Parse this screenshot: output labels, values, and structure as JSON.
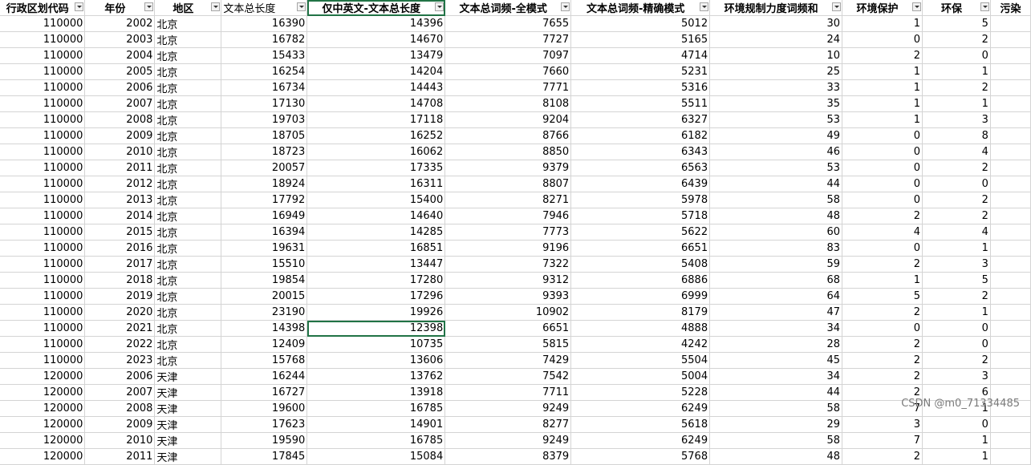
{
  "columns": [
    "行政区划代码",
    "年份",
    "地区",
    "文本总长度",
    "仅中英文-文本总长度",
    "文本总词频-全模式",
    "文本总词频-精确模式",
    "环境规制力度词频和",
    "环境保护",
    "环保",
    "污染"
  ],
  "rows": [
    [
      "110000",
      "2002",
      "北京",
      "16390",
      "14396",
      "7655",
      "5012",
      "30",
      "1",
      "5"
    ],
    [
      "110000",
      "2003",
      "北京",
      "16782",
      "14670",
      "7727",
      "5165",
      "24",
      "0",
      "2"
    ],
    [
      "110000",
      "2004",
      "北京",
      "15433",
      "13479",
      "7097",
      "4714",
      "10",
      "2",
      "0"
    ],
    [
      "110000",
      "2005",
      "北京",
      "16254",
      "14204",
      "7660",
      "5231",
      "25",
      "1",
      "1"
    ],
    [
      "110000",
      "2006",
      "北京",
      "16734",
      "14443",
      "7771",
      "5316",
      "33",
      "1",
      "2"
    ],
    [
      "110000",
      "2007",
      "北京",
      "17130",
      "14708",
      "8108",
      "5511",
      "35",
      "1",
      "1"
    ],
    [
      "110000",
      "2008",
      "北京",
      "19703",
      "17118",
      "9204",
      "6327",
      "53",
      "1",
      "3"
    ],
    [
      "110000",
      "2009",
      "北京",
      "18705",
      "16252",
      "8766",
      "6182",
      "49",
      "0",
      "8"
    ],
    [
      "110000",
      "2010",
      "北京",
      "18723",
      "16062",
      "8850",
      "6343",
      "46",
      "0",
      "4"
    ],
    [
      "110000",
      "2011",
      "北京",
      "20057",
      "17335",
      "9379",
      "6563",
      "53",
      "0",
      "2"
    ],
    [
      "110000",
      "2012",
      "北京",
      "18924",
      "16311",
      "8807",
      "6439",
      "44",
      "0",
      "0"
    ],
    [
      "110000",
      "2013",
      "北京",
      "17792",
      "15400",
      "8271",
      "5978",
      "58",
      "0",
      "2"
    ],
    [
      "110000",
      "2014",
      "北京",
      "16949",
      "14640",
      "7946",
      "5718",
      "48",
      "2",
      "2"
    ],
    [
      "110000",
      "2015",
      "北京",
      "16394",
      "14285",
      "7773",
      "5622",
      "60",
      "4",
      "4"
    ],
    [
      "110000",
      "2016",
      "北京",
      "19631",
      "16851",
      "9196",
      "6651",
      "83",
      "0",
      "1"
    ],
    [
      "110000",
      "2017",
      "北京",
      "15510",
      "13447",
      "7322",
      "5408",
      "59",
      "2",
      "3"
    ],
    [
      "110000",
      "2018",
      "北京",
      "19854",
      "17280",
      "9312",
      "6886",
      "68",
      "1",
      "5"
    ],
    [
      "110000",
      "2019",
      "北京",
      "20015",
      "17296",
      "9393",
      "6999",
      "64",
      "5",
      "2"
    ],
    [
      "110000",
      "2020",
      "北京",
      "23190",
      "19926",
      "10902",
      "8179",
      "47",
      "2",
      "1"
    ],
    [
      "110000",
      "2021",
      "北京",
      "14398",
      "12398",
      "6651",
      "4888",
      "34",
      "0",
      "0"
    ],
    [
      "110000",
      "2022",
      "北京",
      "12409",
      "10735",
      "5815",
      "4242",
      "28",
      "2",
      "0"
    ],
    [
      "110000",
      "2023",
      "北京",
      "15768",
      "13606",
      "7429",
      "5504",
      "45",
      "2",
      "2"
    ],
    [
      "120000",
      "2006",
      "天津",
      "16244",
      "13762",
      "7542",
      "5004",
      "34",
      "2",
      "3"
    ],
    [
      "120000",
      "2007",
      "天津",
      "16727",
      "13918",
      "7711",
      "5228",
      "44",
      "2",
      "6"
    ],
    [
      "120000",
      "2008",
      "天津",
      "19600",
      "16785",
      "9249",
      "6249",
      "58",
      "7",
      "1"
    ],
    [
      "120000",
      "2009",
      "天津",
      "17623",
      "14901",
      "8277",
      "5618",
      "29",
      "3",
      "0"
    ],
    [
      "120000",
      "2010",
      "天津",
      "19590",
      "16785",
      "9249",
      "6249",
      "58",
      "7",
      "1"
    ],
    [
      "120000",
      "2011",
      "天津",
      "17845",
      "15084",
      "8379",
      "5768",
      "48",
      "2",
      "1"
    ]
  ],
  "watermark": "CSDN @m0_71334485",
  "colors": {
    "selection": "#217346",
    "grid": "#d4d4d4"
  }
}
